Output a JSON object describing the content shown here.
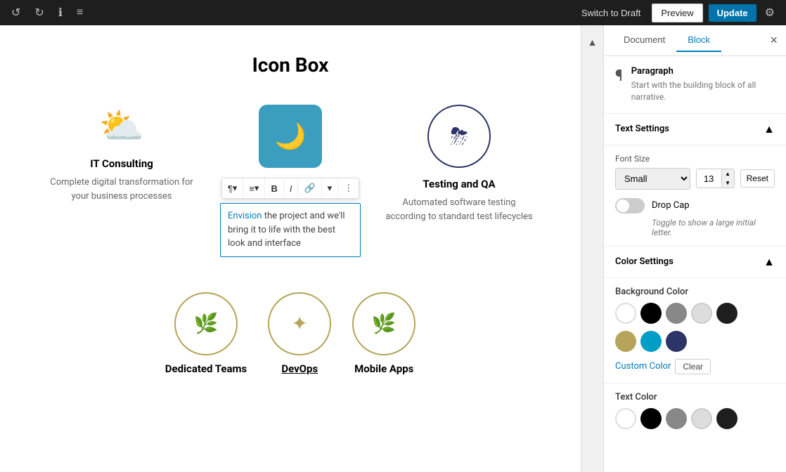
{
  "topbar": {
    "switch_draft_label": "Switch to Draft",
    "preview_label": "Preview",
    "update_label": "Update"
  },
  "panel": {
    "document_tab": "Document",
    "block_tab": "Block",
    "block_name": "Paragraph",
    "block_description": "Start with the building block of all narrative.",
    "text_settings_label": "Text Settings",
    "font_size_label": "Font Size",
    "font_size_option": "Small",
    "font_size_value": "13",
    "reset_label": "Reset",
    "drop_cap_label": "Drop Cap",
    "drop_cap_hint": "Toggle to show a large initial letter.",
    "color_settings_label": "Color Settings",
    "background_color_label": "Background Color",
    "custom_color_label": "Custom Color",
    "clear_label": "Clear",
    "text_color_label": "Text Color"
  },
  "editor": {
    "page_title": "Icon Box",
    "box1_title": "IT Consulting",
    "box1_text": "Complete digital transformation for your business processes",
    "box2_selected_text": "Envision the project and we'll bring it to life with the best look and interface",
    "box3_title": "Testing and QA",
    "box3_text": "Automated software testing according to standard test lifecycles",
    "box4_title": "Dedicated Teams",
    "box5_title": "DevOps",
    "box6_title": "Mobile Apps"
  },
  "icons": {
    "undo": "↺",
    "redo": "↻",
    "info": "ℹ",
    "menu": "≡",
    "gear": "⚙",
    "close": "×",
    "chevron_up": "▲",
    "chevron_down": "▼",
    "paragraph": "¶",
    "align_left": "≡",
    "bold": "B",
    "italic": "I",
    "link": "🔗",
    "more": "⋯",
    "dropdown": "▾",
    "weather_cloud_sun": "⛅",
    "moon_cloud": "🌙",
    "cloud_rain": "⛈",
    "leaf": "🌿",
    "sun_gear": "✦",
    "leaf2": "🌿"
  }
}
